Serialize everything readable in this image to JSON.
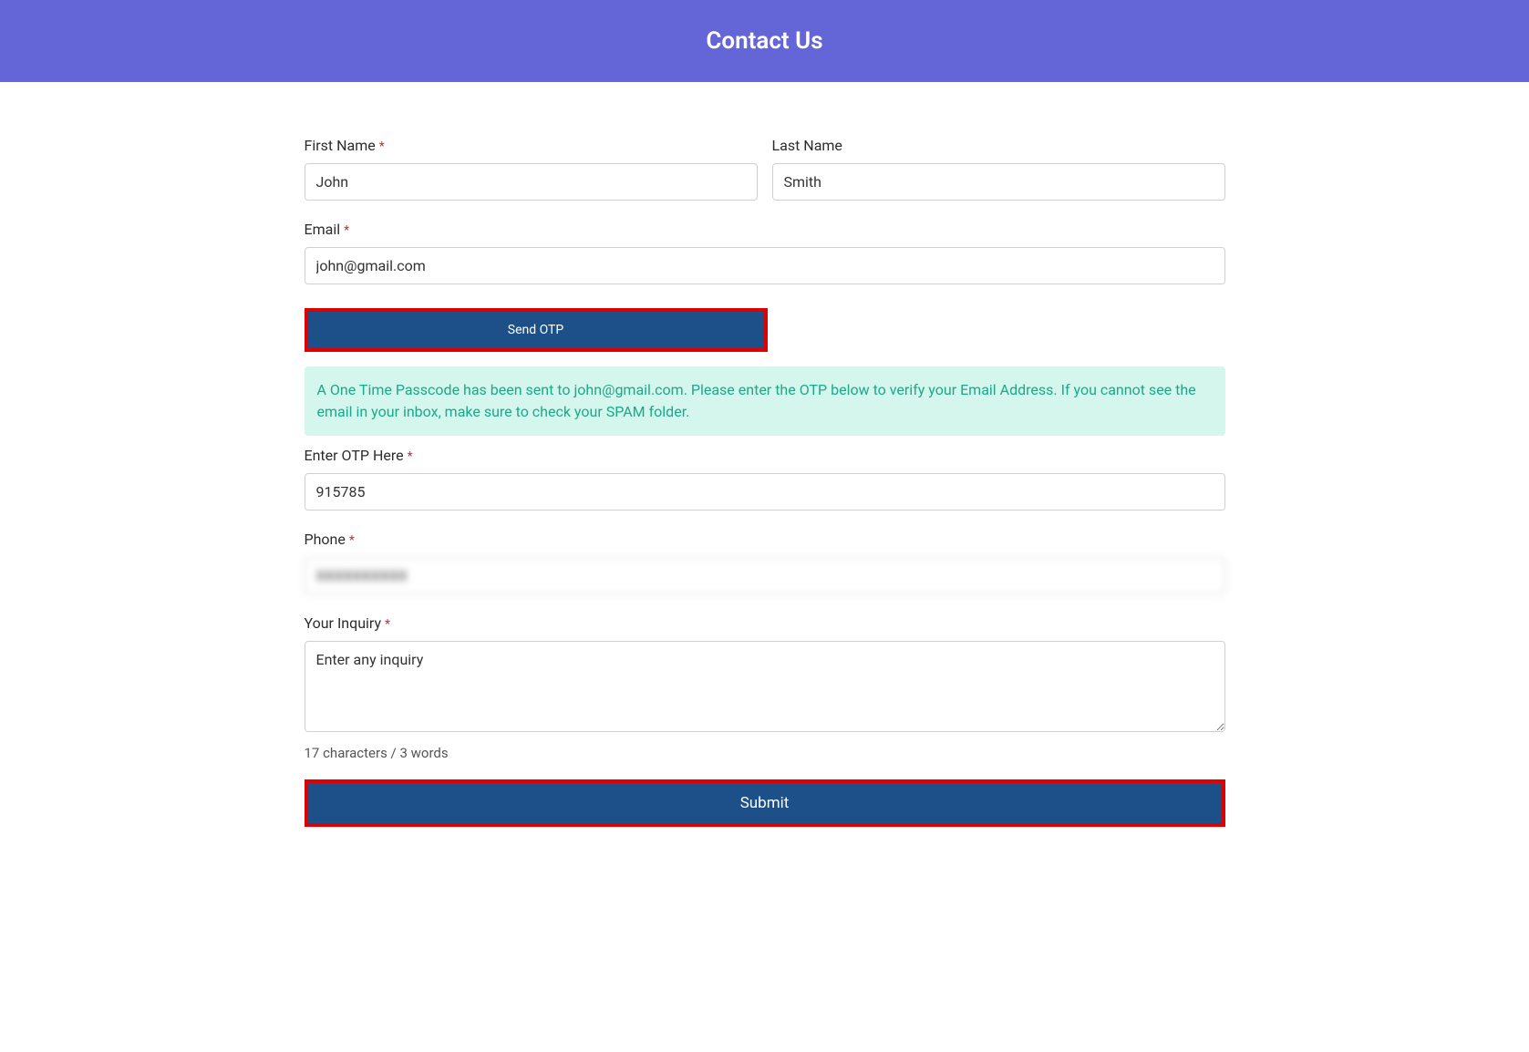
{
  "header": {
    "title": "Contact Us"
  },
  "form": {
    "first_name": {
      "label": "First Name",
      "required_marker": "*",
      "value": "John"
    },
    "last_name": {
      "label": "Last Name",
      "value": "Smith"
    },
    "email": {
      "label": "Email",
      "required_marker": "*",
      "value": "john@gmail.com"
    },
    "send_otp": {
      "label": "Send OTP"
    },
    "otp_info": {
      "message": "A One Time Passcode has been sent to john@gmail.com. Please enter the OTP below to verify your Email Address. If you cannot see the email in your inbox, make sure to check your SPAM folder."
    },
    "otp": {
      "label": "Enter OTP Here",
      "required_marker": "*",
      "value": "915785"
    },
    "phone": {
      "label": "Phone",
      "required_marker": "*",
      "value": "XXXXXXXXXX"
    },
    "inquiry": {
      "label": "Your Inquiry",
      "required_marker": "*",
      "value": "Enter any inquiry"
    },
    "char_count": {
      "text": "17 characters / 3 words"
    },
    "submit": {
      "label": "Submit"
    }
  }
}
